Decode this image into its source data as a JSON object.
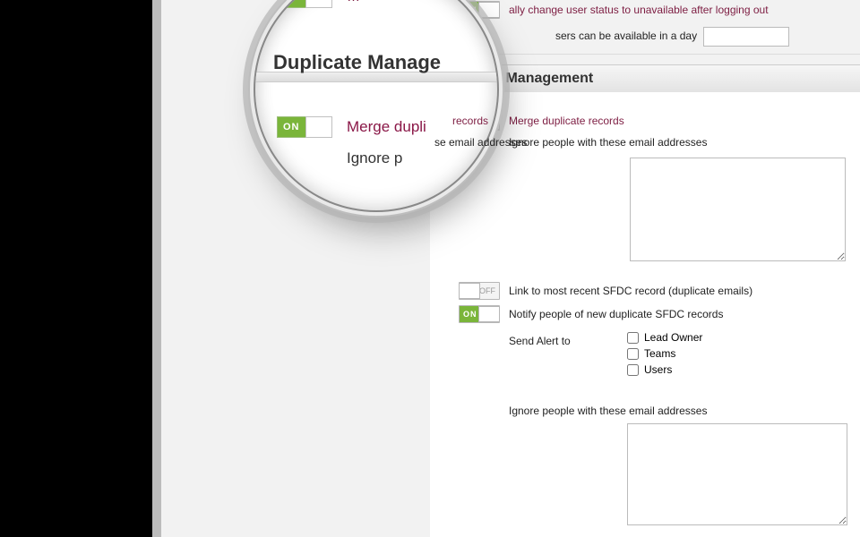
{
  "top": {
    "auto_status_label": "ally change user status to unavailable after logging out",
    "max_hours_label": "sers can be available in a day",
    "max_hours_value": ""
  },
  "section": {
    "title": "Duplicate Management"
  },
  "settings": {
    "merge": {
      "state": "ON",
      "label": "Merge duplicate records"
    },
    "ignore1_label": "Ignore people with these email addresses",
    "ignore1_value": "",
    "link_recent": {
      "state": "OFF",
      "label": "Link to most recent SFDC record (duplicate emails)"
    },
    "notify": {
      "state": "ON",
      "label": "Notify people of new duplicate SFDC records"
    },
    "send_alert_label": "Send Alert to",
    "alert_options": {
      "lead_owner": "Lead Owner",
      "teams": "Teams",
      "users": "Users"
    },
    "ignore2_label": "Ignore people with these email addresses",
    "ignore2_value": ""
  },
  "magnifier": {
    "title": "Duplicate Manage",
    "toggle_text": "ON",
    "label1": "Merge dupli",
    "label2": "Ignore p",
    "tail1": "records",
    "tail2": "se email addresses"
  }
}
